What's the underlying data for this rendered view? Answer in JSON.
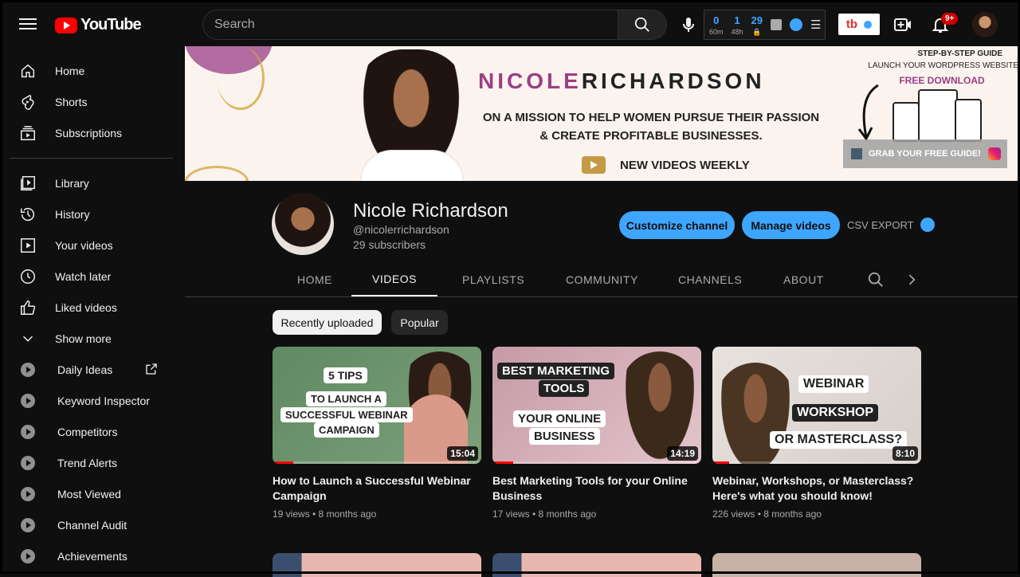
{
  "topbar": {
    "logo_text": "YouTube",
    "search_placeholder": "Search",
    "ext_stats": [
      {
        "value": "0",
        "label": "60m"
      },
      {
        "value": "1",
        "label": "48h"
      },
      {
        "value": "29",
        "label": ""
      }
    ],
    "tb_label": "tb",
    "notif_badge": "9+"
  },
  "sidebar": {
    "main": [
      {
        "label": "Home",
        "icon": "home-icon"
      },
      {
        "label": "Shorts",
        "icon": "shorts-icon"
      },
      {
        "label": "Subscriptions",
        "icon": "subscriptions-icon"
      }
    ],
    "library": [
      {
        "label": "Library",
        "icon": "library-icon"
      },
      {
        "label": "History",
        "icon": "history-icon"
      },
      {
        "label": "Your videos",
        "icon": "your-videos-icon"
      },
      {
        "label": "Watch later",
        "icon": "watch-later-icon"
      },
      {
        "label": "Liked videos",
        "icon": "liked-icon"
      },
      {
        "label": "Show more",
        "icon": "chevron-down-icon"
      }
    ],
    "extensions": [
      {
        "label": "Daily Ideas"
      },
      {
        "label": "Keyword Inspector"
      },
      {
        "label": "Competitors"
      },
      {
        "label": "Trend Alerts"
      },
      {
        "label": "Most Viewed"
      },
      {
        "label": "Channel Audit"
      },
      {
        "label": "Achievements"
      }
    ]
  },
  "banner": {
    "name_first": "NICOLE",
    "name_last": "RICHARDSON",
    "tagline_1": "ON A MISSION TO HELP WOMEN PURSUE THEIR PASSION",
    "tagline_2": "& CREATE PROFITABLE BUSINESSES.",
    "weekly": "NEW VIDEOS WEEKLY",
    "guide_title": "STEP-BY-STEP GUIDE",
    "guide_sub": "LAUNCH YOUR WORDPRESS WEBSITE",
    "free_download": "FREE DOWNLOAD",
    "guide_cta": "GRAB YOUR FREE GUIDE!"
  },
  "channel": {
    "name": "Nicole Richardson",
    "handle": "@nicolerrichardson",
    "subscribers": "29 subscribers",
    "customize_label": "Customize channel",
    "manage_label": "Manage videos",
    "csv_label": "CSV EXPORT"
  },
  "tabs": [
    "HOME",
    "VIDEOS",
    "PLAYLISTS",
    "COMMUNITY",
    "CHANNELS",
    "ABOUT"
  ],
  "chips": [
    "Recently uploaded",
    "Popular"
  ],
  "videos": [
    {
      "title_1": "How to Launch a Successful Webinar",
      "title_2": "Campaign",
      "meta": "19 views • 8 months ago",
      "duration": "15:04",
      "thumb_lines": [
        "5 TIPS",
        "TO LAUNCH A",
        "SUCCESSFUL WEBINAR",
        "CAMPAIGN"
      ],
      "progress": 0.1
    },
    {
      "title_1": "Best Marketing Tools for your Online",
      "title_2": "Business",
      "meta": "17 views • 8 months ago",
      "duration": "14:19",
      "thumb_lines": [
        "BEST MARKETING",
        "TOOLS",
        "YOUR ONLINE",
        "BUSINESS"
      ],
      "progress": 0.1
    },
    {
      "title_1": "Webinar, Workshops, or Masterclass?",
      "title_2": "Here's what you should know!",
      "meta": "226 views • 8 months ago",
      "duration": "8:10",
      "thumb_lines": [
        "WEBINAR",
        "WORKSHOP",
        "OR MASTERCLASS?"
      ],
      "progress": 0.08
    }
  ],
  "colors": {
    "accent_blue": "#3ea6ff",
    "brand_red": "#ff0000",
    "banner_purple": "#9a3e86"
  }
}
